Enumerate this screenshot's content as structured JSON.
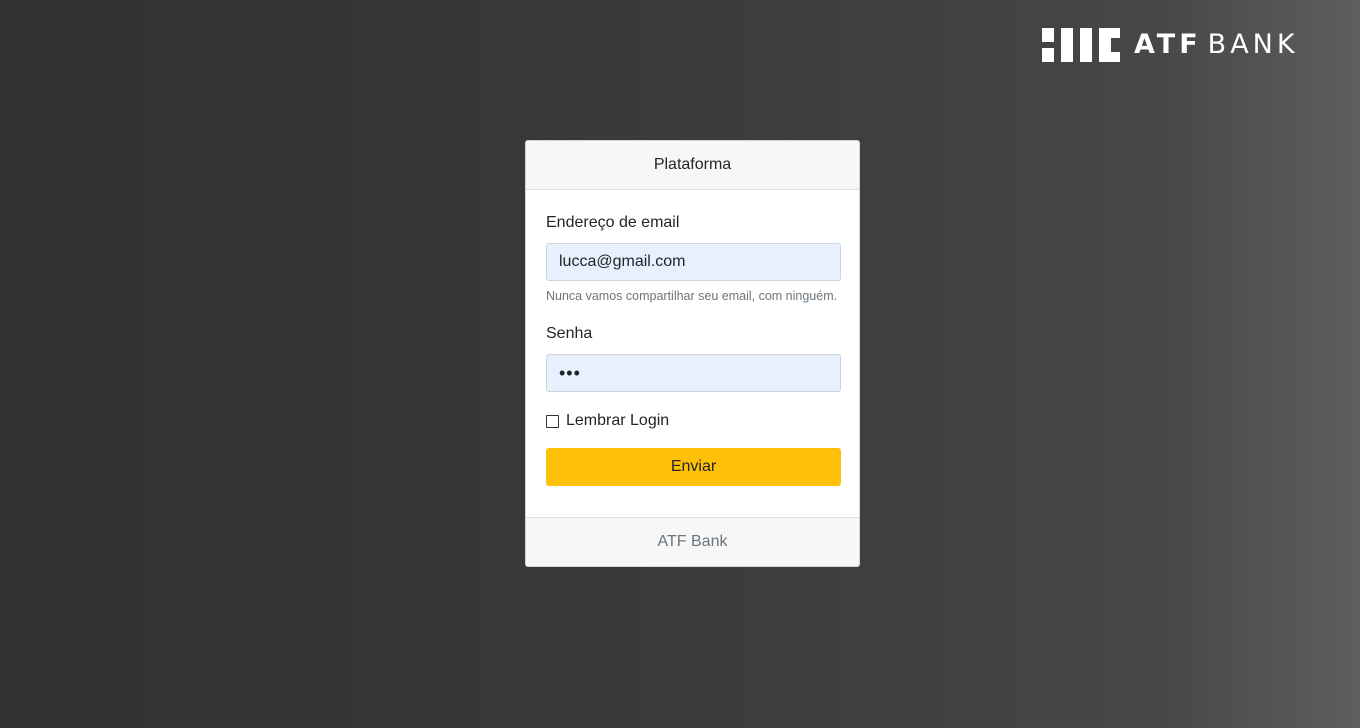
{
  "brand": {
    "logo_icon": "atf-bank-logo-icon",
    "atf": "ATF",
    "bank": "BANK"
  },
  "card": {
    "header_title": "Plataforma",
    "footer_text": "ATF Bank"
  },
  "form": {
    "email_label": "Endereço de email",
    "email_value": "lucca@gmail.com",
    "email_help": "Nunca vamos compartilhar seu email, com ninguém.",
    "password_label": "Senha",
    "password_value": "•••",
    "remember_label": "Lembrar Login",
    "remember_checked": false,
    "submit_label": "Enviar"
  },
  "colors": {
    "accent": "#ffc107",
    "autofill_bg": "#e8f0fe",
    "background": "#363636"
  }
}
